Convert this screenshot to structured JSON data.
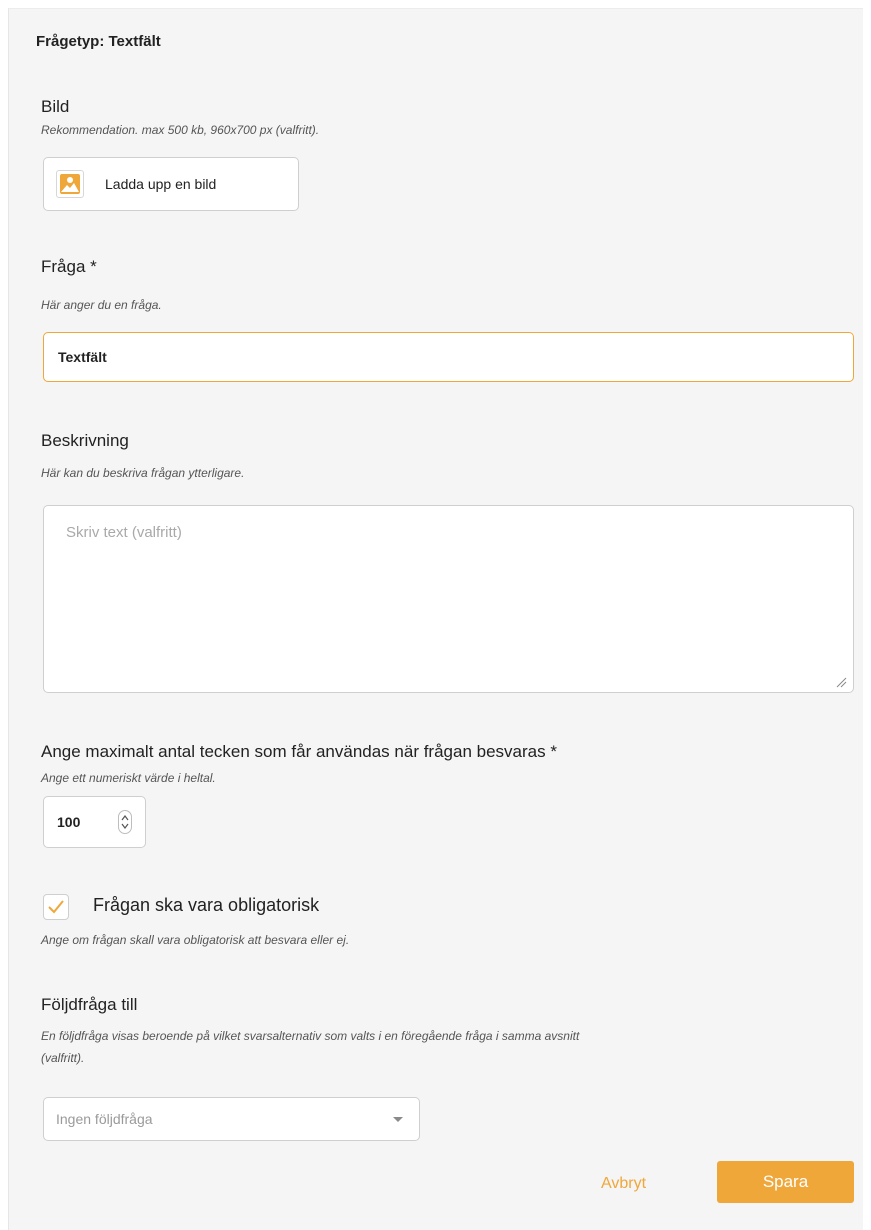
{
  "header": {
    "title": "Frågetyp: Textfält"
  },
  "image_section": {
    "label": "Bild",
    "hint": "Rekommendation. max 500 kb, 960x700 px (valfritt).",
    "upload_button_label": "Ladda upp en bild",
    "icon": "image-icon"
  },
  "question_section": {
    "label": "Fråga *",
    "hint": "Här anger du en fråga.",
    "value": "Textfält"
  },
  "description_section": {
    "label": "Beskrivning",
    "hint": "Här kan du beskriva frågan ytterligare.",
    "placeholder": "Skriv text (valfritt)"
  },
  "max_chars_section": {
    "label": "Ange maximalt antal tecken som får användas när frågan besvaras *",
    "hint": "Ange ett numeriskt värde i heltal.",
    "value": "100"
  },
  "required_section": {
    "checked": true,
    "label": "Frågan ska vara obligatorisk",
    "hint": "Ange om frågan skall vara obligatorisk att besvara eller ej."
  },
  "followup_section": {
    "label": "Följdfråga till",
    "hint_line1": "En följdfråga visas beroende på vilket svarsalternativ som valts i en föregående fråga i samma avsnitt",
    "hint_line2": "(valfritt).",
    "selected": "Ingen följdfråga"
  },
  "actions": {
    "cancel_label": "Avbryt",
    "save_label": "Spara"
  },
  "colors": {
    "accent": "#f0a73a",
    "background": "#f5f5f5",
    "border": "#cfcfcf"
  }
}
